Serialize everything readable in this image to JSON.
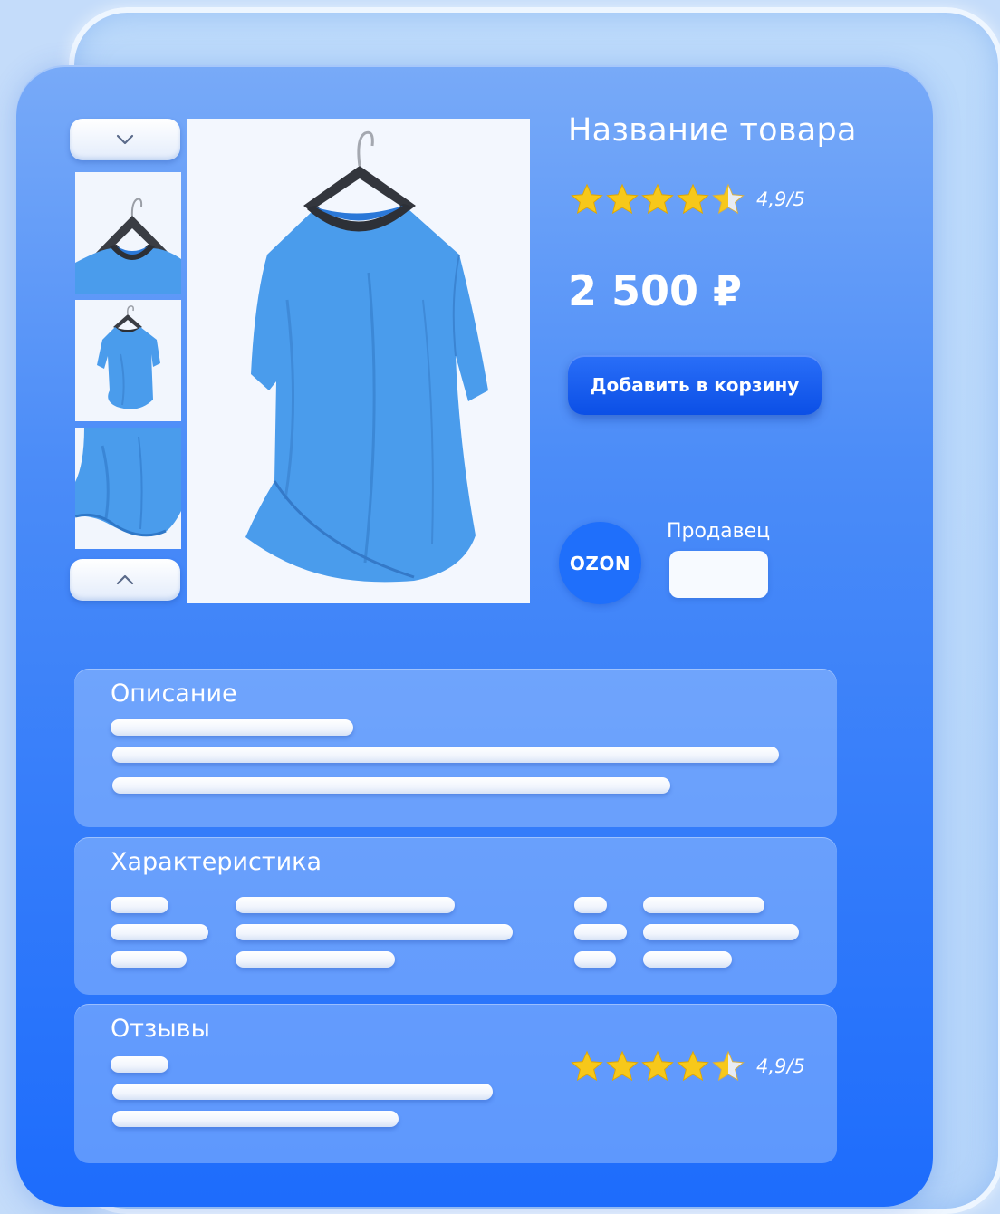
{
  "product": {
    "title": "Название товара",
    "rating": {
      "value": 4.9,
      "max": 5,
      "text": "4,9/5",
      "stars_filled": 4.5
    },
    "price": "2 500 ₽",
    "add_to_cart_label": "Добавить в корзину"
  },
  "gallery": {
    "arrow_up_icon": "chevron-down-icon",
    "arrow_down_icon": "chevron-up-icon",
    "thumbnails": [
      "tshirt-collar-closeup",
      "tshirt-full",
      "tshirt-bottom"
    ],
    "main_image": "blue-tshirt-on-hanger"
  },
  "seller": {
    "logo_text": "OZON",
    "label": "Продавец",
    "name": ""
  },
  "sections": {
    "description": {
      "title": "Описание"
    },
    "specs": {
      "title": "Характеристика"
    },
    "reviews": {
      "title": "Отзывы",
      "rating_text": "4,9/5",
      "stars_filled": 4.5
    }
  },
  "colors": {
    "panel_top": "#78aaf8",
    "panel_bottom": "#1d6cfc",
    "button": "#0b4fe6",
    "star": "#f7c81a",
    "tshirt": "#4a9cec"
  }
}
